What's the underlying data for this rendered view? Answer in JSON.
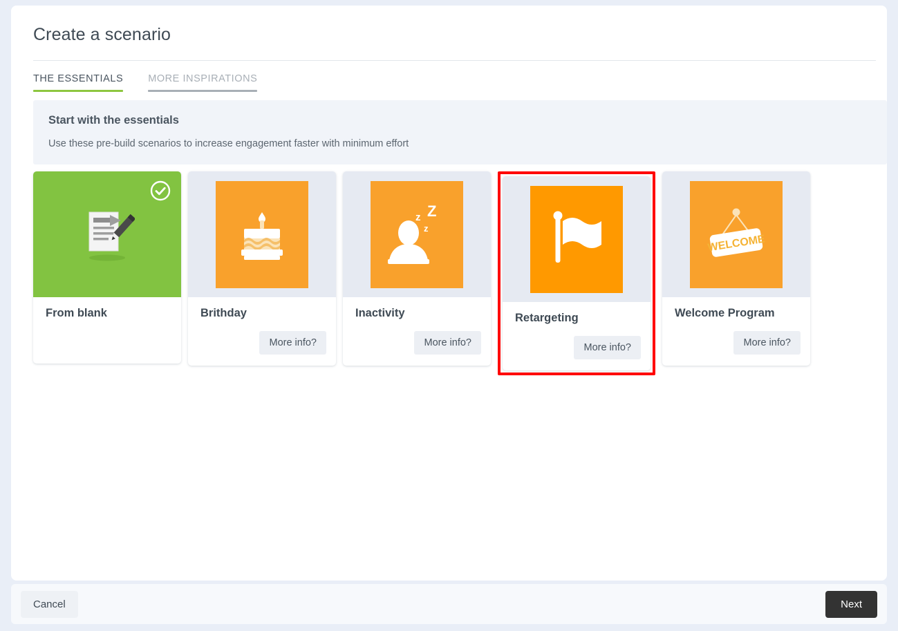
{
  "header": {
    "title": "Create a scenario"
  },
  "tabs": [
    {
      "label": "THE ESSENTIALS",
      "active": true
    },
    {
      "label": "MORE INSPIRATIONS",
      "active": false
    }
  ],
  "banner": {
    "title": "Start with the essentials",
    "subtitle": "Use these pre-build scenarios to increase engagement faster with minimum effort"
  },
  "cards": [
    {
      "title": "From blank",
      "icon": "document-pencil-icon",
      "thumb_style": "full-green",
      "thumb_color": "#82c341",
      "selected": true,
      "selected_icon": "check-circle-icon",
      "more_info_label": "",
      "has_more_info": false,
      "highlighted": false
    },
    {
      "title": "Brithday",
      "icon": "birthday-cake-icon",
      "thumb_style": "inset-orange",
      "thumb_color": "#f9a12c",
      "selected": false,
      "more_info_label": "More info?",
      "has_more_info": true,
      "highlighted": false
    },
    {
      "title": "Inactivity",
      "icon": "sleeping-person-icon",
      "thumb_style": "inset-orange",
      "thumb_color": "#f9a12c",
      "selected": false,
      "more_info_label": "More info?",
      "has_more_info": true,
      "highlighted": false
    },
    {
      "title": "Retargeting",
      "icon": "flag-icon",
      "thumb_style": "inset-orange-vivid",
      "thumb_color": "#ff9900",
      "selected": false,
      "more_info_label": "More info?",
      "has_more_info": true,
      "highlighted": true
    },
    {
      "title": "Welcome Program",
      "icon": "welcome-sign-icon",
      "icon_text": "WELCOME",
      "thumb_style": "inset-orange",
      "thumb_color": "#f9a12c",
      "selected": false,
      "more_info_label": "More info?",
      "has_more_info": true,
      "highlighted": false
    }
  ],
  "footer": {
    "cancel_label": "Cancel",
    "next_label": "Next"
  },
  "colors": {
    "accent_green": "#8dc63f",
    "orange": "#f9a12c",
    "orange_vivid": "#ff9900",
    "highlight_red": "#ff0000",
    "panel_bg": "#ffffff",
    "page_bg": "#e9eef7",
    "banner_bg": "#f1f4f9"
  }
}
